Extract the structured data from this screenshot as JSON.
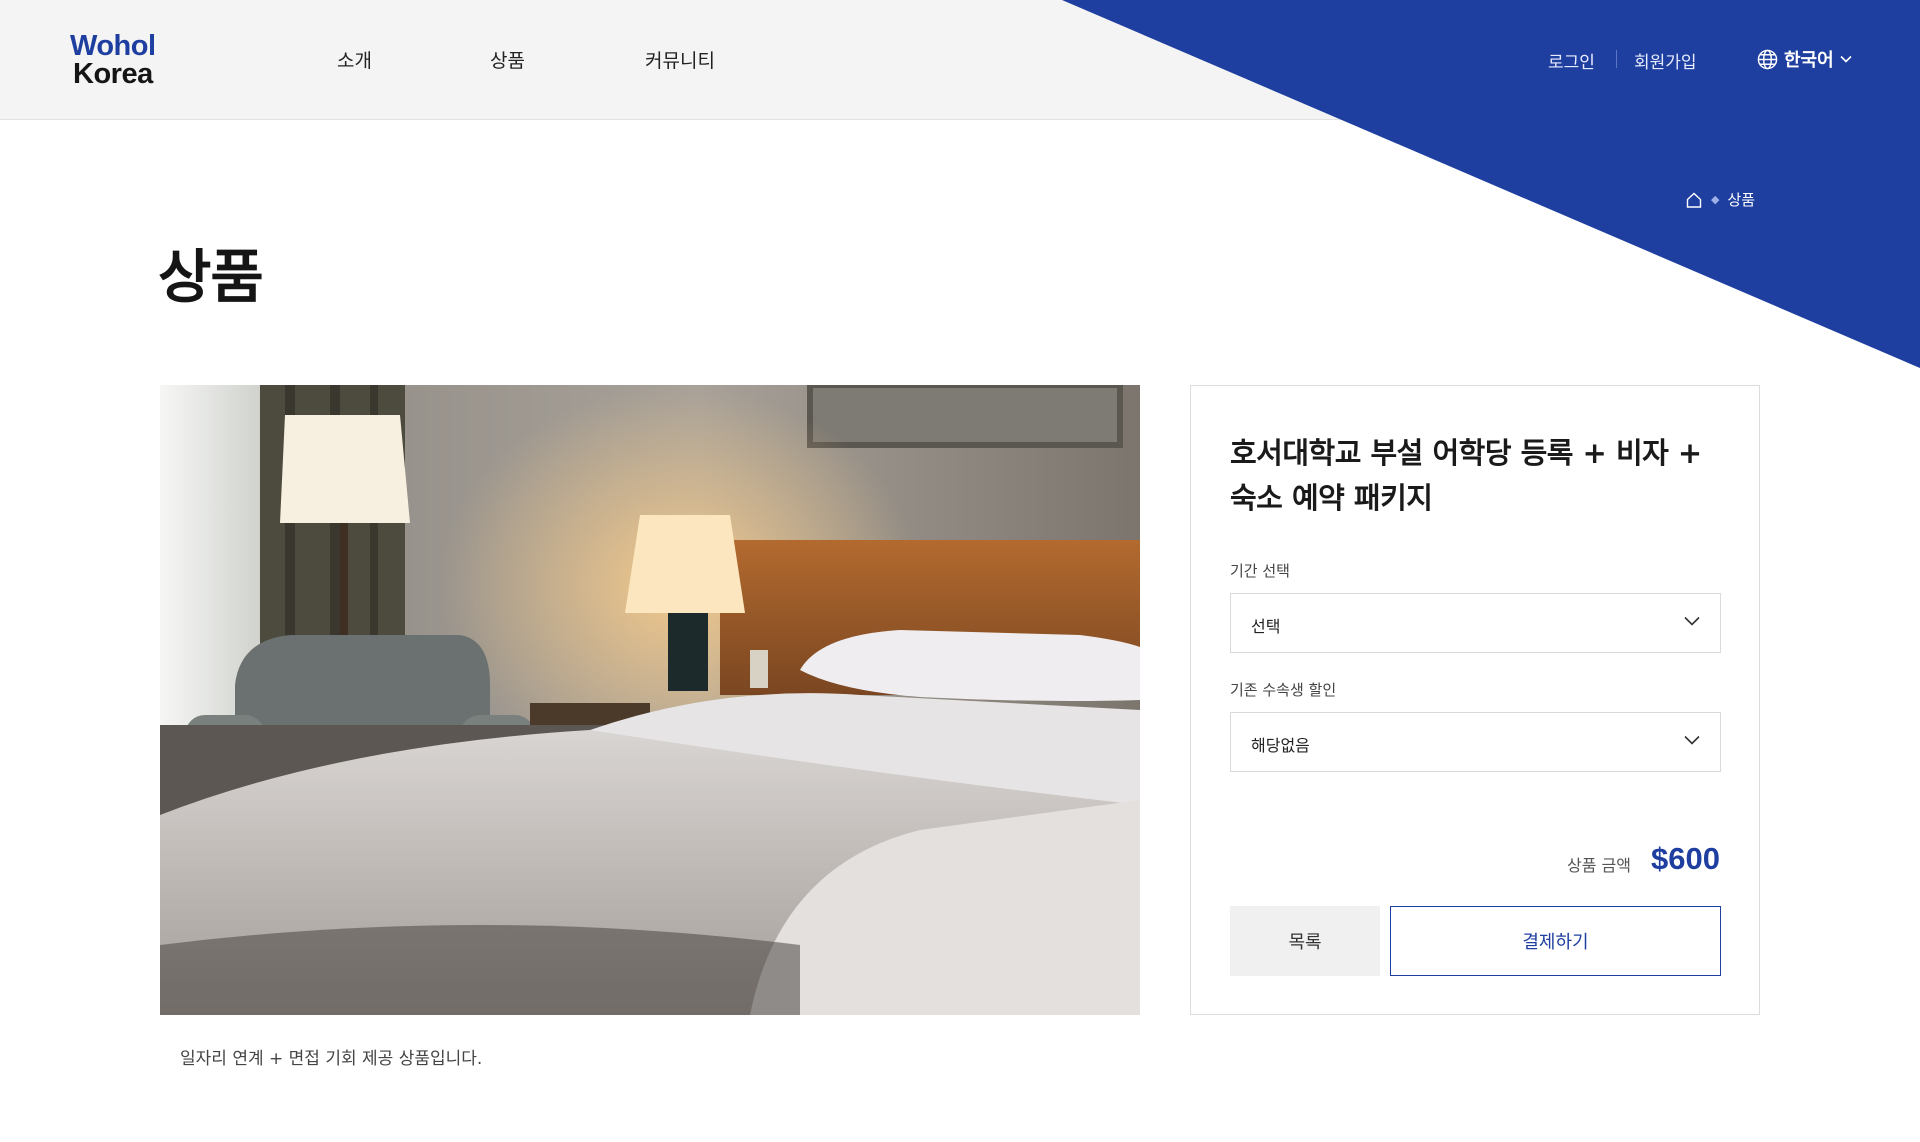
{
  "brand": {
    "line1": "Wohol",
    "line2": "Korea",
    "accent_color": "#1e3fa0"
  },
  "nav": {
    "items": [
      {
        "label": "소개"
      },
      {
        "label": "상품"
      },
      {
        "label": "커뮤니티"
      }
    ]
  },
  "auth": {
    "login": "로그인",
    "signup": "회원가입"
  },
  "language": {
    "label": "한국어",
    "icon": "globe-icon"
  },
  "breadcrumb": {
    "home_icon": "home-icon",
    "current": "상품"
  },
  "page": {
    "title": "상품"
  },
  "product": {
    "image_alt": "hotel room with beds and lamps",
    "description": "일자리 연계 + 면접 기회 제공 상품입니다.",
    "title_line1": "호서대학교 부설 어학당 등록 + 비자 +",
    "title_line2": "숙소 예약 패키지",
    "period": {
      "label": "기간 선택",
      "value": "선택"
    },
    "discount": {
      "label": "기존 수속생 할인",
      "value": "해당없음"
    },
    "price_label": "상품 금액",
    "price": "$600",
    "list_button": "목록",
    "pay_button": "결제하기"
  }
}
